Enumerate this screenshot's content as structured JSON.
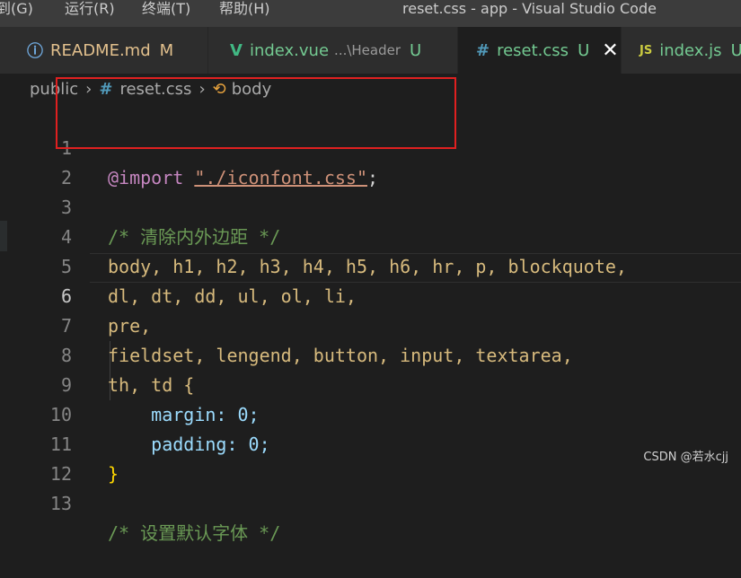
{
  "titlebar": {
    "menus": [
      "到(G)",
      "运行(R)",
      "终端(T)",
      "帮助(H)"
    ],
    "title": "reset.css - app - Visual Studio Code"
  },
  "tabs": [
    {
      "icon": "ⓘ",
      "icon_name": "info-icon",
      "label": "README.md",
      "path": "",
      "status": "M"
    },
    {
      "icon": "V",
      "icon_name": "vue-icon",
      "label": "index.vue",
      "path": "...\\Header",
      "status": "U"
    },
    {
      "icon": "#",
      "icon_name": "css-icon",
      "label": "reset.css",
      "path": "",
      "status": "U",
      "active": true,
      "close": "✕"
    },
    {
      "icon": "JS",
      "icon_name": "javascript-icon",
      "label": "index.js",
      "path": "",
      "status": "U"
    }
  ],
  "breadcrumb": {
    "folder": "public",
    "file_icon": "#",
    "file": "reset.css",
    "symbol_icon": "⟲",
    "symbol": "body"
  },
  "editor": {
    "lines": [
      {
        "n": "1",
        "code": "@import \"./iconfont.css\";"
      },
      {
        "n": "2",
        "code": ""
      },
      {
        "n": "3",
        "code": "/* 清除内外边距 */"
      },
      {
        "n": "4",
        "code": "body, h1, h2, h3, h4, h5, h6, hr, p, blockquote,"
      },
      {
        "n": "5",
        "code": "dl, dt, dd, ul, ol, li,"
      },
      {
        "n": "6",
        "code": "pre,"
      },
      {
        "n": "7",
        "code": "fieldset, lengend, button, input, textarea,"
      },
      {
        "n": "8",
        "code": "th, td {"
      },
      {
        "n": "9",
        "code": "    margin: 0;"
      },
      {
        "n": "10",
        "code": "    padding: 0;"
      },
      {
        "n": "11",
        "code": "}"
      },
      {
        "n": "12",
        "code": ""
      },
      {
        "n": "13",
        "code": "/* 设置默认字体 */"
      }
    ],
    "import_kw": "@import",
    "import_str": "\"./iconfont.css\"",
    "semicolon": ";",
    "current_line": "6"
  },
  "watermark": "CSDN @若水cjj",
  "colors": {
    "accent_highlight": "#e02020",
    "keyword": "#c586c0",
    "string": "#ce9178",
    "comment": "#6a9955",
    "selector": "#d7ba7d",
    "property": "#9cdcfe",
    "number": "#b5cea8"
  }
}
